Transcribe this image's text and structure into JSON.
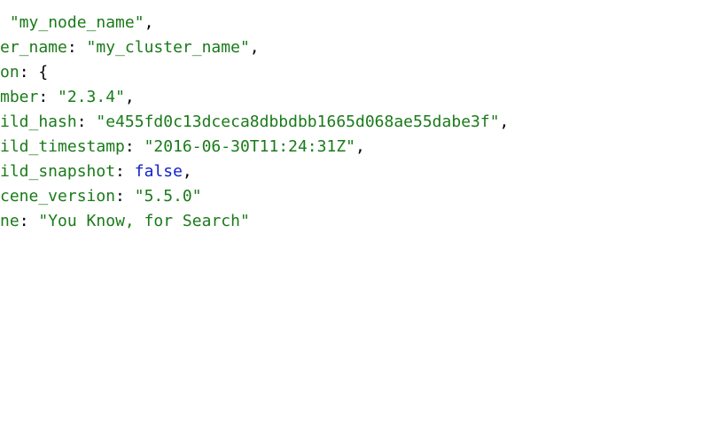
{
  "lines": [
    {
      "indent": " ",
      "segments": [
        {
          "cls": "str",
          "path": "data.name"
        },
        {
          "cls": "punct",
          "path": "punct.comma"
        }
      ]
    },
    {
      "indent": "",
      "segments": [
        {
          "cls": "key",
          "path": "keys.cluster_name_trunc"
        },
        {
          "cls": "punct",
          "path": "punct.colon_space"
        },
        {
          "cls": "str",
          "path": "data.cluster_name"
        },
        {
          "cls": "punct",
          "path": "punct.comma"
        }
      ]
    },
    {
      "indent": "",
      "segments": [
        {
          "cls": "key",
          "path": "keys.version_trunc"
        },
        {
          "cls": "punct",
          "path": "punct.colon_space"
        },
        {
          "cls": "punct",
          "path": "punct.open_brace"
        }
      ]
    },
    {
      "indent": "",
      "segments": [
        {
          "cls": "key",
          "path": "keys.number_trunc"
        },
        {
          "cls": "punct",
          "path": "punct.colon_space"
        },
        {
          "cls": "str",
          "path": "data.version.number"
        },
        {
          "cls": "punct",
          "path": "punct.comma"
        }
      ]
    },
    {
      "indent": "",
      "segments": [
        {
          "cls": "key",
          "path": "keys.build_hash_trunc"
        },
        {
          "cls": "punct",
          "path": "punct.colon_space"
        },
        {
          "cls": "str",
          "path": "data.version.build_hash"
        },
        {
          "cls": "punct",
          "path": "punct.comma"
        }
      ]
    },
    {
      "indent": "",
      "segments": [
        {
          "cls": "key",
          "path": "keys.build_timestamp_trunc"
        },
        {
          "cls": "punct",
          "path": "punct.colon_space"
        },
        {
          "cls": "str",
          "path": "data.version.build_timestamp"
        },
        {
          "cls": "punct",
          "path": "punct.comma"
        }
      ]
    },
    {
      "indent": "",
      "segments": [
        {
          "cls": "key",
          "path": "keys.build_snapshot_trunc"
        },
        {
          "cls": "punct",
          "path": "punct.colon_space"
        },
        {
          "cls": "bool",
          "path": "data.version.build_snapshot"
        },
        {
          "cls": "punct",
          "path": "punct.comma"
        }
      ]
    },
    {
      "indent": "",
      "segments": [
        {
          "cls": "key",
          "path": "keys.lucene_version_trunc"
        },
        {
          "cls": "punct",
          "path": "punct.colon_space"
        },
        {
          "cls": "str",
          "path": "data.version.lucene_version"
        }
      ]
    },
    {
      "indent": "",
      "segments": []
    },
    {
      "indent": "",
      "segments": [
        {
          "cls": "key",
          "path": "keys.tagline_trunc"
        },
        {
          "cls": "punct",
          "path": "punct.colon_space"
        },
        {
          "cls": "str",
          "path": "data.tagline"
        }
      ]
    }
  ],
  "keys": {
    "cluster_name_trunc": "er_name",
    "version_trunc": "on",
    "number_trunc": "mber",
    "build_hash_trunc": "ild_hash",
    "build_timestamp_trunc": "ild_timestamp",
    "build_snapshot_trunc": "ild_snapshot",
    "lucene_version_trunc": "cene_version",
    "tagline_trunc": "ne"
  },
  "data": {
    "name": "\"my_node_name\"",
    "cluster_name": "\"my_cluster_name\"",
    "version": {
      "number": "\"2.3.4\"",
      "build_hash": "\"e455fd0c13dceca8dbbdbb1665d068ae55dabe3f\"",
      "build_timestamp": "\"2016-06-30T11:24:31Z\"",
      "build_snapshot": "false",
      "lucene_version": "\"5.5.0\""
    },
    "tagline": "\"You Know, for Search\""
  },
  "punct": {
    "comma": ",",
    "colon_space": ": ",
    "open_brace": "{"
  }
}
